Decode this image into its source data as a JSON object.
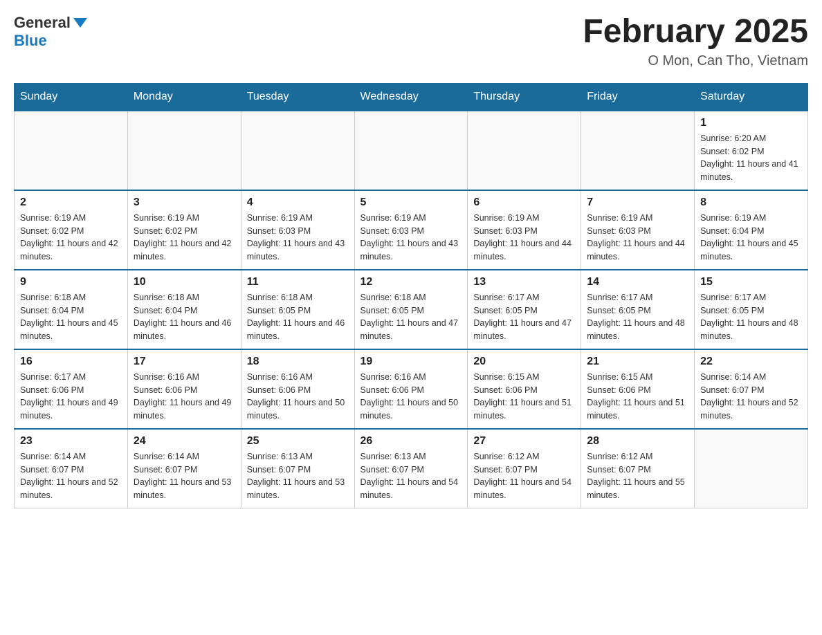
{
  "header": {
    "logo_general": "General",
    "logo_blue": "Blue",
    "title": "February 2025",
    "location": "O Mon, Can Tho, Vietnam"
  },
  "days_of_week": [
    "Sunday",
    "Monday",
    "Tuesday",
    "Wednesday",
    "Thursday",
    "Friday",
    "Saturday"
  ],
  "weeks": [
    [
      {
        "day": "",
        "info": ""
      },
      {
        "day": "",
        "info": ""
      },
      {
        "day": "",
        "info": ""
      },
      {
        "day": "",
        "info": ""
      },
      {
        "day": "",
        "info": ""
      },
      {
        "day": "",
        "info": ""
      },
      {
        "day": "1",
        "info": "Sunrise: 6:20 AM\nSunset: 6:02 PM\nDaylight: 11 hours and 41 minutes."
      }
    ],
    [
      {
        "day": "2",
        "info": "Sunrise: 6:19 AM\nSunset: 6:02 PM\nDaylight: 11 hours and 42 minutes."
      },
      {
        "day": "3",
        "info": "Sunrise: 6:19 AM\nSunset: 6:02 PM\nDaylight: 11 hours and 42 minutes."
      },
      {
        "day": "4",
        "info": "Sunrise: 6:19 AM\nSunset: 6:03 PM\nDaylight: 11 hours and 43 minutes."
      },
      {
        "day": "5",
        "info": "Sunrise: 6:19 AM\nSunset: 6:03 PM\nDaylight: 11 hours and 43 minutes."
      },
      {
        "day": "6",
        "info": "Sunrise: 6:19 AM\nSunset: 6:03 PM\nDaylight: 11 hours and 44 minutes."
      },
      {
        "day": "7",
        "info": "Sunrise: 6:19 AM\nSunset: 6:03 PM\nDaylight: 11 hours and 44 minutes."
      },
      {
        "day": "8",
        "info": "Sunrise: 6:19 AM\nSunset: 6:04 PM\nDaylight: 11 hours and 45 minutes."
      }
    ],
    [
      {
        "day": "9",
        "info": "Sunrise: 6:18 AM\nSunset: 6:04 PM\nDaylight: 11 hours and 45 minutes."
      },
      {
        "day": "10",
        "info": "Sunrise: 6:18 AM\nSunset: 6:04 PM\nDaylight: 11 hours and 46 minutes."
      },
      {
        "day": "11",
        "info": "Sunrise: 6:18 AM\nSunset: 6:05 PM\nDaylight: 11 hours and 46 minutes."
      },
      {
        "day": "12",
        "info": "Sunrise: 6:18 AM\nSunset: 6:05 PM\nDaylight: 11 hours and 47 minutes."
      },
      {
        "day": "13",
        "info": "Sunrise: 6:17 AM\nSunset: 6:05 PM\nDaylight: 11 hours and 47 minutes."
      },
      {
        "day": "14",
        "info": "Sunrise: 6:17 AM\nSunset: 6:05 PM\nDaylight: 11 hours and 48 minutes."
      },
      {
        "day": "15",
        "info": "Sunrise: 6:17 AM\nSunset: 6:05 PM\nDaylight: 11 hours and 48 minutes."
      }
    ],
    [
      {
        "day": "16",
        "info": "Sunrise: 6:17 AM\nSunset: 6:06 PM\nDaylight: 11 hours and 49 minutes."
      },
      {
        "day": "17",
        "info": "Sunrise: 6:16 AM\nSunset: 6:06 PM\nDaylight: 11 hours and 49 minutes."
      },
      {
        "day": "18",
        "info": "Sunrise: 6:16 AM\nSunset: 6:06 PM\nDaylight: 11 hours and 50 minutes."
      },
      {
        "day": "19",
        "info": "Sunrise: 6:16 AM\nSunset: 6:06 PM\nDaylight: 11 hours and 50 minutes."
      },
      {
        "day": "20",
        "info": "Sunrise: 6:15 AM\nSunset: 6:06 PM\nDaylight: 11 hours and 51 minutes."
      },
      {
        "day": "21",
        "info": "Sunrise: 6:15 AM\nSunset: 6:06 PM\nDaylight: 11 hours and 51 minutes."
      },
      {
        "day": "22",
        "info": "Sunrise: 6:14 AM\nSunset: 6:07 PM\nDaylight: 11 hours and 52 minutes."
      }
    ],
    [
      {
        "day": "23",
        "info": "Sunrise: 6:14 AM\nSunset: 6:07 PM\nDaylight: 11 hours and 52 minutes."
      },
      {
        "day": "24",
        "info": "Sunrise: 6:14 AM\nSunset: 6:07 PM\nDaylight: 11 hours and 53 minutes."
      },
      {
        "day": "25",
        "info": "Sunrise: 6:13 AM\nSunset: 6:07 PM\nDaylight: 11 hours and 53 minutes."
      },
      {
        "day": "26",
        "info": "Sunrise: 6:13 AM\nSunset: 6:07 PM\nDaylight: 11 hours and 54 minutes."
      },
      {
        "day": "27",
        "info": "Sunrise: 6:12 AM\nSunset: 6:07 PM\nDaylight: 11 hours and 54 minutes."
      },
      {
        "day": "28",
        "info": "Sunrise: 6:12 AM\nSunset: 6:07 PM\nDaylight: 11 hours and 55 minutes."
      },
      {
        "day": "",
        "info": ""
      }
    ]
  ]
}
